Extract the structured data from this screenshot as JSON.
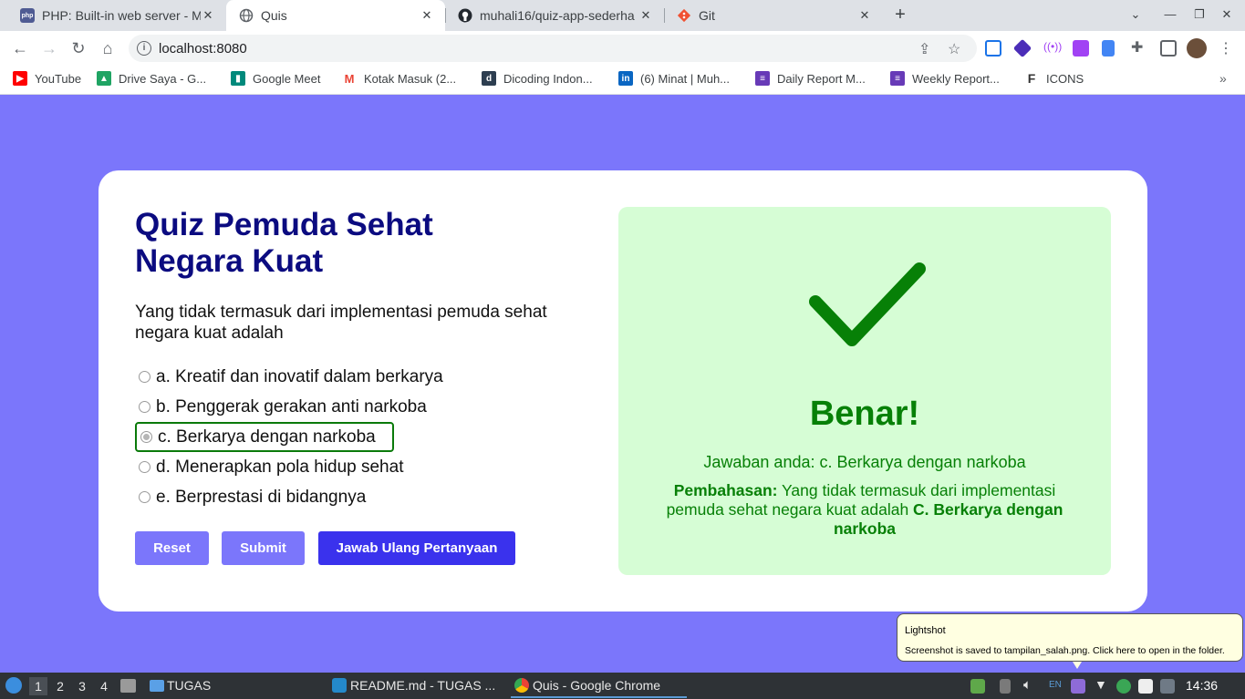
{
  "browser": {
    "tabs": [
      {
        "title": "PHP: Built-in web server - M",
        "favicon": "php-icon",
        "active": false
      },
      {
        "title": "Quis",
        "favicon": "globe-icon",
        "active": true
      },
      {
        "title": "muhali16/quiz-app-sederha",
        "favicon": "github-icon",
        "active": false
      },
      {
        "title": "Git",
        "favicon": "git-icon",
        "active": false
      }
    ],
    "address": "localhost:8080",
    "bookmarks": [
      {
        "label": "YouTube",
        "icon": "youtube-icon",
        "color": "#ff0000"
      },
      {
        "label": "Drive Saya - G...",
        "icon": "drive-icon",
        "color": "#1fa463"
      },
      {
        "label": "Google Meet",
        "icon": "meet-icon",
        "color": "#00897b"
      },
      {
        "label": "Kotak Masuk (2...",
        "icon": "gmail-icon",
        "color": "#ea4335"
      },
      {
        "label": "Dicoding Indon...",
        "icon": "dicoding-icon",
        "color": "#2d3e50"
      },
      {
        "label": "(6) Minat | Muh...",
        "icon": "linkedin-icon",
        "color": "#0a66c2"
      },
      {
        "label": "Daily Report M...",
        "icon": "forms-icon",
        "color": "#673ab7"
      },
      {
        "label": "Weekly Report...",
        "icon": "forms-icon",
        "color": "#673ab7"
      },
      {
        "label": "ICONS",
        "icon": "f-icon",
        "color": "#333333"
      }
    ]
  },
  "quiz": {
    "title": "Quiz Pemuda Sehat Negara Kuat",
    "question": "Yang tidak termasuk dari implementasi pemuda sehat negara kuat adalah",
    "options": [
      {
        "label": "a. Kreatif dan inovatif dalam berkarya",
        "selected": false
      },
      {
        "label": "b. Penggerak gerakan anti narkoba",
        "selected": false
      },
      {
        "label": "c. Berkarya dengan narkoba",
        "selected": true
      },
      {
        "label": "d. Menerapkan pola hidup sehat",
        "selected": false
      },
      {
        "label": "e. Berprestasi di bidangnya",
        "selected": false
      }
    ],
    "buttons": {
      "reset": "Reset",
      "submit": "Submit",
      "retry": "Jawab Ulang Pertanyaan"
    },
    "result": {
      "status": "Benar!",
      "answer": "Jawaban anda: c. Berkarya dengan narkoba",
      "explanation_label": "Pembahasan:",
      "explanation_text": " Yang tidak termasuk dari implementasi pemuda sehat negara kuat adalah ",
      "explanation_answer": "C. Berkarya dengan narkoba",
      "color": "#078007",
      "background": "#d6fdd5"
    }
  },
  "notification": {
    "title": "Lightshot",
    "body": "Screenshot is saved to tampilan_salah.png. Click here to open in the folder."
  },
  "taskbar": {
    "workspaces": [
      "1",
      "2",
      "3",
      "4"
    ],
    "folder": "TUGAS",
    "apps": [
      {
        "label": "README.md - TUGAS ...",
        "icon": "vscode-icon"
      },
      {
        "label": "Quis - Google Chrome",
        "icon": "chrome-icon"
      }
    ],
    "keyboard_layout": "EN",
    "clock": "14:36"
  }
}
